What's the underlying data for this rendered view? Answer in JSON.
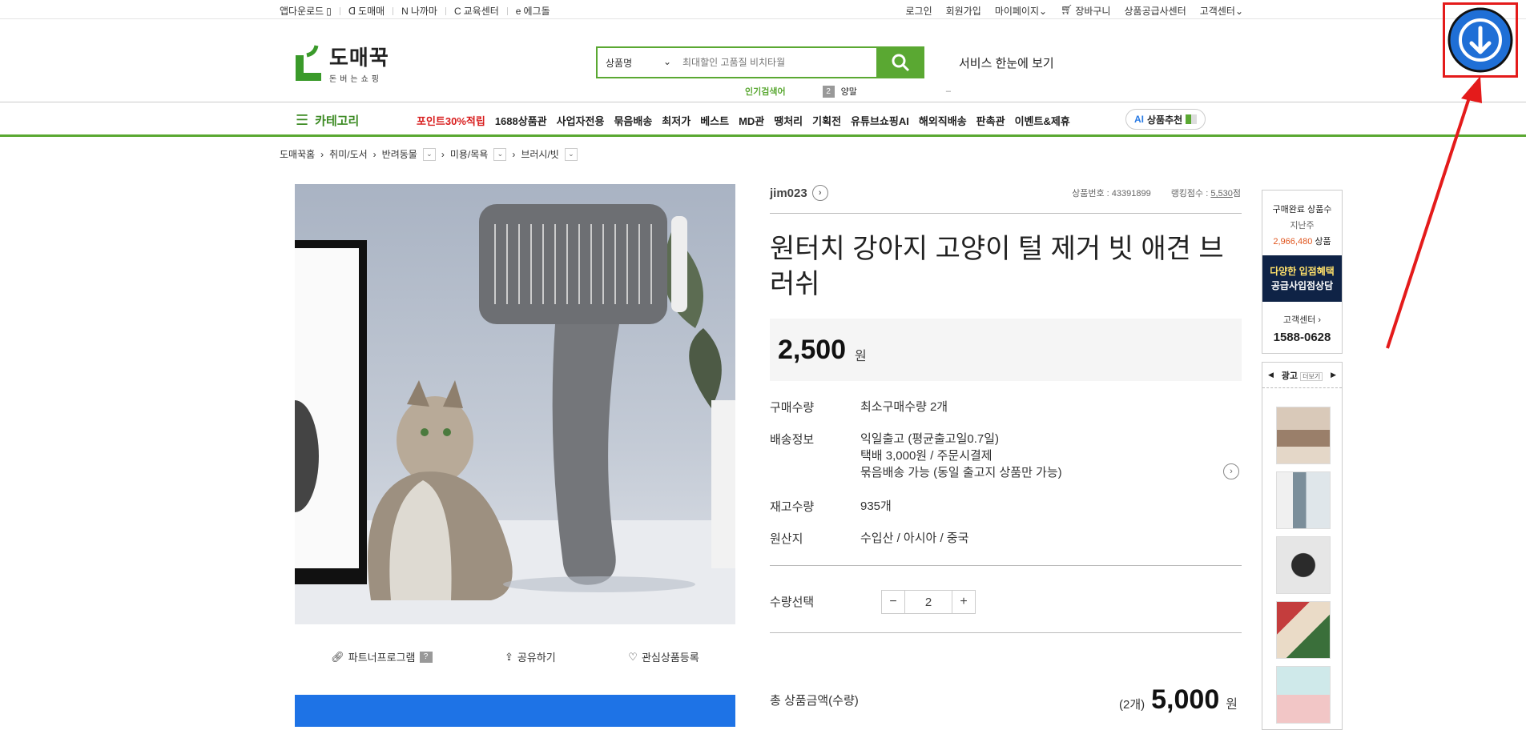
{
  "topbar": {
    "left": [
      "앱다운로드",
      "도매매",
      "나까마",
      "교육센터",
      "에그돌"
    ],
    "right": [
      "로그인",
      "회원가입",
      "마이페이지",
      "장바구니",
      "상품공급사센터",
      "고객센터"
    ]
  },
  "logo": {
    "name": "도매꾹",
    "slogan": "돈버는쇼핑"
  },
  "search": {
    "type": "상품명",
    "placeholder": "최대할인 고품질 비치타월"
  },
  "service_link": "서비스 한눈에 보기",
  "popular": {
    "label": "인기검색어",
    "rank": "2",
    "keyword": "양말",
    "dash": "–"
  },
  "gnb": {
    "category": "카테고리",
    "menu_red": "포인트30%적립",
    "menu": [
      "1688상품관",
      "사업자전용",
      "묶음배송",
      "최저가",
      "베스트",
      "MD관",
      "땡처리",
      "기획전",
      "유튜브쇼핑AI",
      "해외직배송",
      "판촉관",
      "이벤트&제휴"
    ],
    "ai_badge": "AI",
    "ai_label": "상품추천"
  },
  "breadcrumb": [
    "도매꾹홈",
    "취미/도서",
    "반려동물",
    "미용/목욕",
    "브러시/빗"
  ],
  "actions": {
    "partner": "파트너프로그램",
    "help": "?",
    "share": "공유하기",
    "wish": "관심상품등록"
  },
  "product": {
    "seller": "jim023",
    "number_label": "상품번호 : 43391899",
    "ranking_label": "랭킹점수 :",
    "ranking_value": "5,530",
    "ranking_unit": "점",
    "title": "원터치 강아지 고양이 털 제거 빗 애견 브러쉬",
    "price": "2,500",
    "won": "원",
    "rows": [
      {
        "key": "구매수량",
        "value": "최소구매수량 2개"
      },
      {
        "key": "배송정보",
        "value": "익일출고 (평균출고일0.7일)"
      },
      {
        "key": "",
        "value": "택배 3,000원 / 주문시결제"
      },
      {
        "key": "",
        "value": "묶음배송 가능 (동일 출고지 상품만 가능)"
      },
      {
        "key": "재고수량",
        "value": "935개"
      },
      {
        "key": "원산지",
        "value": "수입산 / 아시아 / 중국"
      }
    ],
    "qty_label": "수량선택",
    "qty_minus": "−",
    "qty_value": "2",
    "qty_plus": "+",
    "total_label": "총 상품금액(수량)",
    "total_count": "(2개)",
    "total_price": "5,000",
    "total_won": "원"
  },
  "sidebar": {
    "sold_title": "구매완료 상품수",
    "sold_period": "지난주",
    "sold_count": "2,966,480",
    "sold_unit": "상품",
    "banner_l1": "다양한 입점혜택",
    "banner_l2": "공급사입점상담",
    "cs_label": "고객센터",
    "cs_phone": "1588-0628",
    "ad_label": "광고",
    "ad_more": "더보기",
    "ad_prev": "◀",
    "ad_next": "▶"
  },
  "colors": {
    "brand_green": "#5aa832",
    "point_red": "#d81c1c",
    "sold_orange": "#e0561f",
    "download_blue": "#1f6fd6"
  }
}
